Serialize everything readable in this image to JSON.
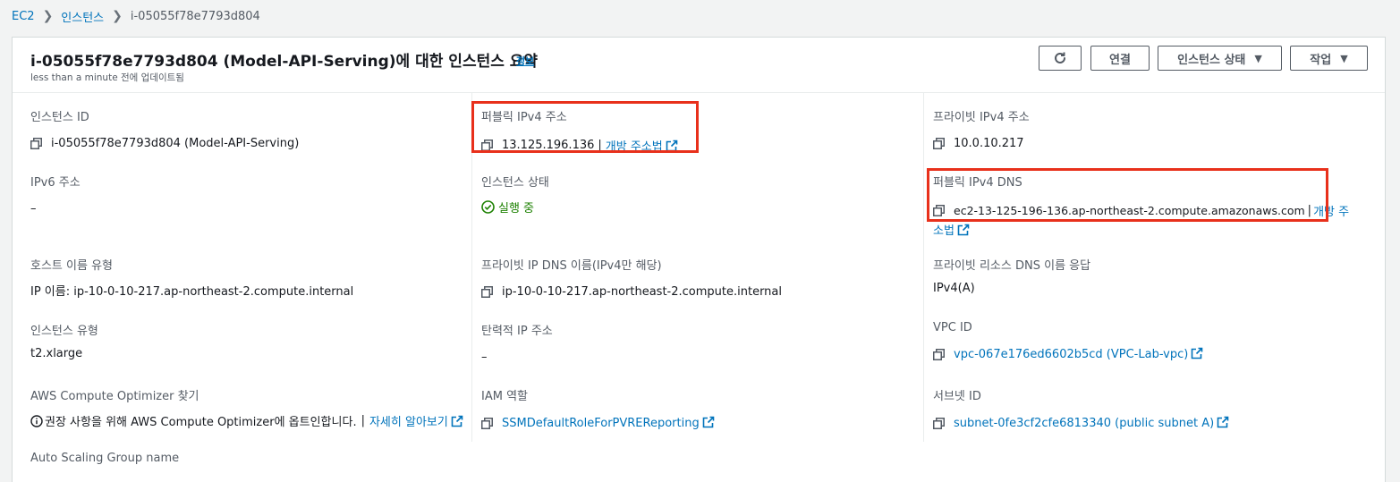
{
  "breadcrumb": {
    "items": [
      "EC2",
      "인스턴스",
      "i-05055f78e7793d804"
    ]
  },
  "header": {
    "title": "i-05055f78e7793d804 (Model-API-Serving)에 대한 인스턴스 요약",
    "info_label": "정보",
    "subtitle": "less than a minute 전에 업데이트됨",
    "connect_label": "연결",
    "state_label": "인스턴스 상태",
    "actions_label": "작업"
  },
  "fields": {
    "instance_id": {
      "label": "인스턴스 ID",
      "value": "i-05055f78e7793d804 (Model-API-Serving)"
    },
    "public_ipv4": {
      "label": "퍼블릭 IPv4 주소",
      "value": "13.125.196.136",
      "link": "개방 주소법"
    },
    "private_ipv4": {
      "label": "프라이빗 IPv4 주소",
      "value": "10.0.10.217"
    },
    "ipv6": {
      "label": "IPv6 주소",
      "value": "–"
    },
    "instance_state": {
      "label": "인스턴스 상태",
      "value": "실행 중"
    },
    "public_dns": {
      "label": "퍼블릭 IPv4 DNS",
      "value": "ec2-13-125-196-136.ap-northeast-2.compute.amazonaws.com",
      "sep": "|",
      "link_part1": "개방 주",
      "link_part2": "소법"
    },
    "hostname_type": {
      "label": "호스트 이름 유형",
      "value": "IP 이름: ip-10-0-10-217.ap-northeast-2.compute.internal"
    },
    "private_dns": {
      "label": "프라이빗 IP DNS 이름(IPv4만 해당)",
      "value": "ip-10-0-10-217.ap-northeast-2.compute.internal"
    },
    "private_resource_dns": {
      "label": "프라이빗 리소스 DNS 이름 응답",
      "value": "IPv4(A)"
    },
    "instance_type": {
      "label": "인스턴스 유형",
      "value": "t2.xlarge"
    },
    "elastic_ip": {
      "label": "탄력적 IP 주소",
      "value": "–"
    },
    "vpc_id": {
      "label": "VPC ID",
      "value": "vpc-067e176ed6602b5cd (VPC-Lab-vpc)"
    },
    "compute_optimizer": {
      "label": "AWS Compute Optimizer 찾기",
      "value": "권장 사항을 위해 AWS Compute Optimizer에 옵트인합니다.",
      "sep": "|",
      "link": "자세히 알아보기"
    },
    "iam_role": {
      "label": "IAM 역할",
      "value": "SSMDefaultRoleForPVREReporting"
    },
    "subnet_id": {
      "label": "서브넷 ID",
      "value": "subnet-0fe3cf2cfe6813340 (public subnet A)"
    },
    "asg_name": {
      "label": "Auto Scaling Group name",
      "value": "–"
    }
  },
  "colors": {
    "link": "#0073bb",
    "running": "#1d8102",
    "highlight": "#e8301b"
  }
}
